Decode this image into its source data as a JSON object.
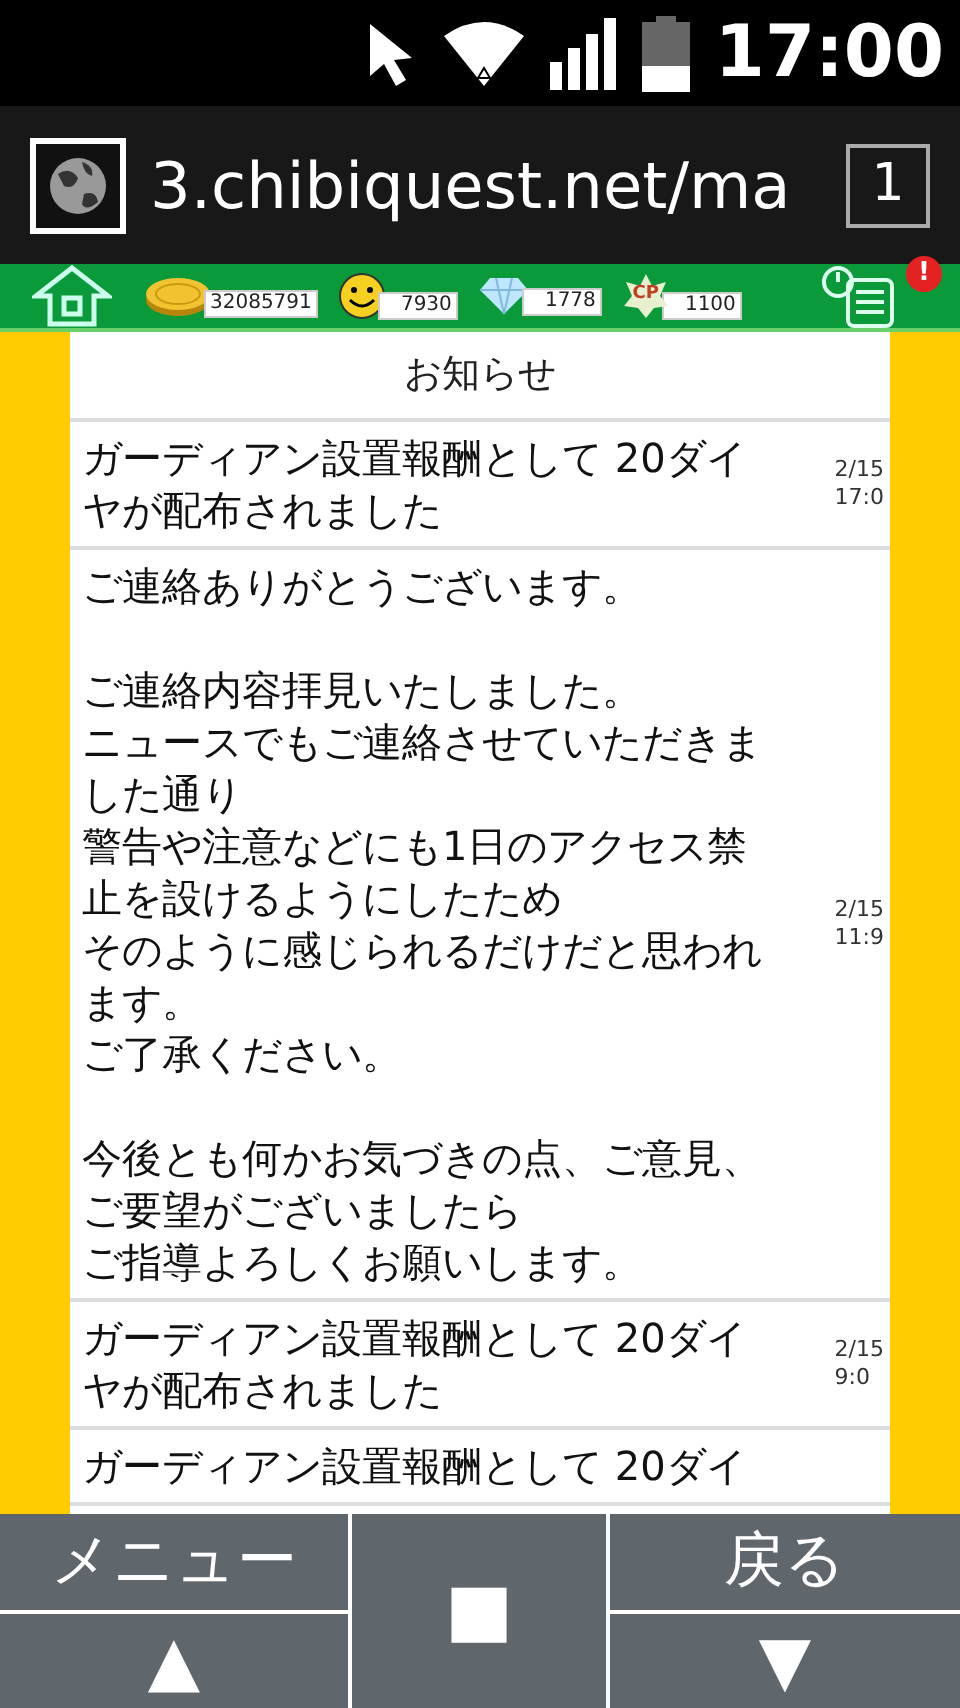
{
  "status_bar": {
    "time": "17:00"
  },
  "browser": {
    "url": "3.chibiquest.net/ma",
    "tab_count": "1"
  },
  "toolbar": {
    "counters": [
      {
        "kind": "gold",
        "value": "32085791"
      },
      {
        "kind": "smile",
        "value": "7930"
      },
      {
        "kind": "diamond",
        "value": "1778"
      },
      {
        "kind": "cp",
        "value": "1100",
        "icon_text": "CP"
      }
    ],
    "alert_badge": "!"
  },
  "notices": {
    "title": "お知らせ",
    "items": [
      {
        "paragraphs": [
          [
            "ガーディアン設置報酬として 20ダイヤが配布されました"
          ]
        ],
        "date": "2/15\n17:0"
      },
      {
        "paragraphs": [
          [
            "ご連絡ありがとうございます。"
          ],
          [
            "ご連絡内容拝見いたしました。",
            "ニュースでもご連絡させていただきました通り",
            "警告や注意などにも1日のアクセス禁止を設けるようにしたため",
            "そのように感じられるだけだと思われます。",
            "ご了承ください。"
          ],
          [
            "今後とも何かお気づきの点、ご意見、ご要望がございましたら",
            "ご指導よろしくお願いします。"
          ]
        ],
        "date": "2/15\n11:9"
      },
      {
        "paragraphs": [
          [
            "ガーディアン設置報酬として 20ダイヤが配布されました"
          ]
        ],
        "date": "2/15\n9:0"
      },
      {
        "paragraphs": [
          [
            "ガーディアン設置報酬として 20ダイ"
          ]
        ]
      }
    ]
  },
  "bottom_bar": {
    "menu": "メニュー",
    "up": "▲",
    "stop": "■",
    "back": "戻る",
    "down": "▼"
  }
}
